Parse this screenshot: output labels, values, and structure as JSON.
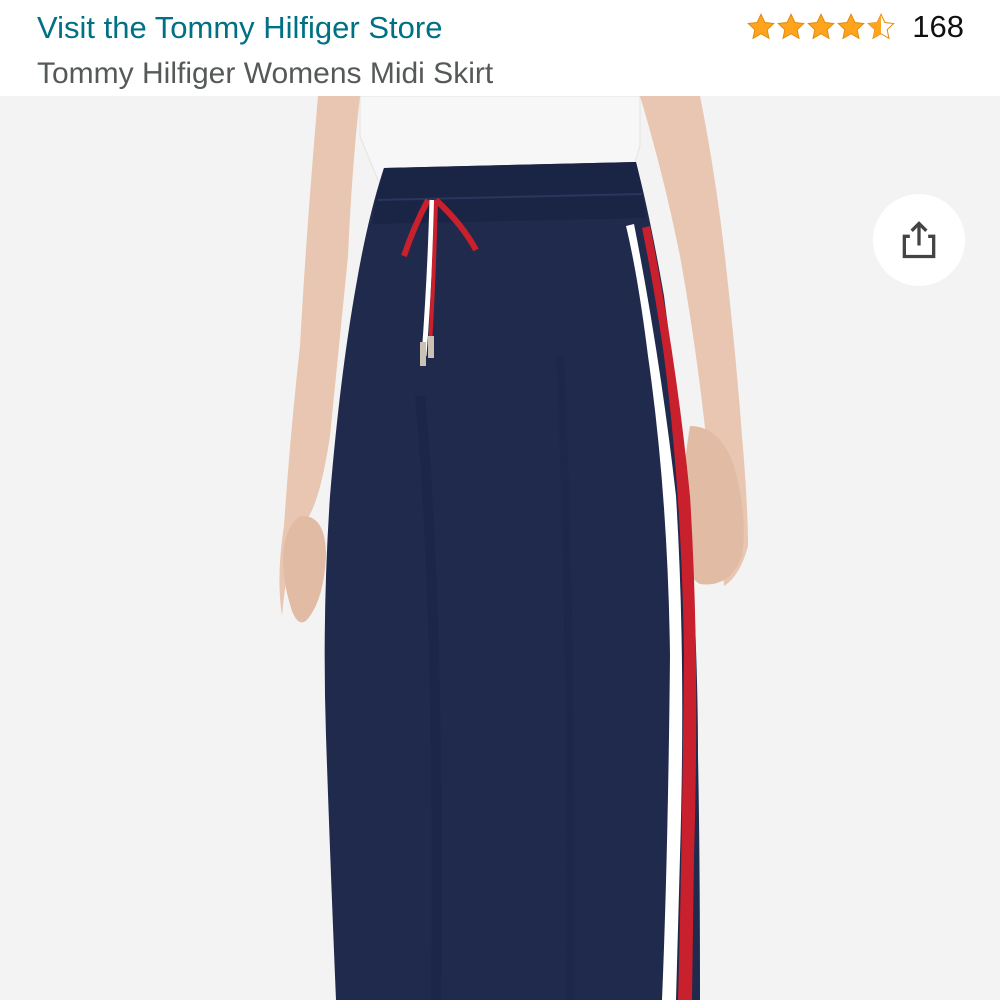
{
  "header": {
    "store_link": "Visit the Tommy Hilfiger Store",
    "product_title": "Tommy Hilfiger Womens Midi Skirt",
    "rating": {
      "stars": 4.5,
      "count": "168",
      "star_color": "#FFA41C"
    }
  },
  "image": {
    "alt": "Tommy Hilfiger Womens Midi Skirt"
  },
  "share": {
    "icon": "share-icon"
  },
  "colors": {
    "link": "#007185",
    "title": "#565959",
    "skirt_navy": "#1f2a4d",
    "stripe_red": "#c8202c",
    "background": "#f3f3f3"
  }
}
